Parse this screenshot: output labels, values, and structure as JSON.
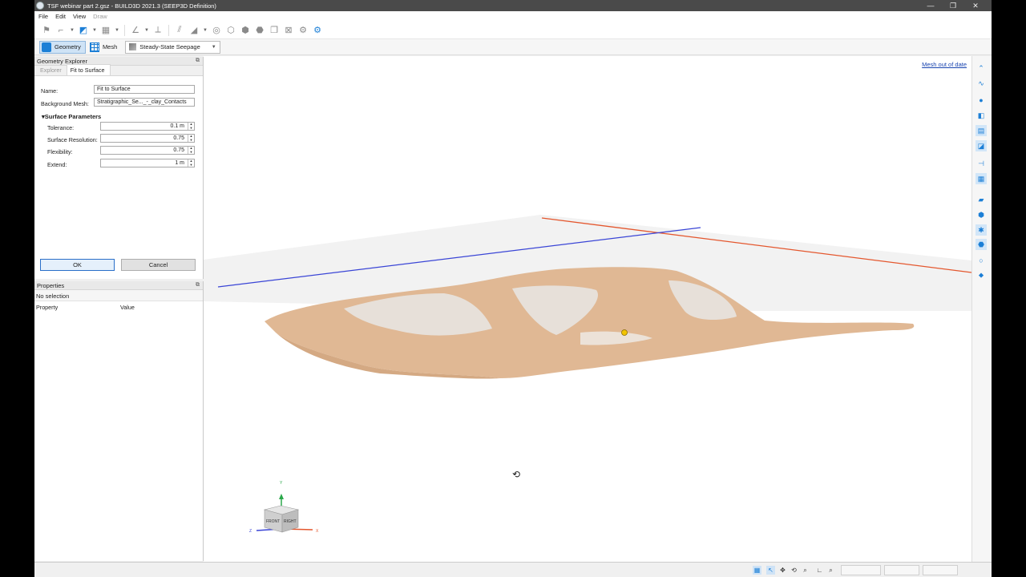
{
  "window": {
    "title": "TSF webinar part 2.gsz - BUILD3D 2021.3 (SEEP3D Definition)",
    "minimize": "—",
    "restore": "❐",
    "close": "✕"
  },
  "menu": {
    "file": "File",
    "edit": "Edit",
    "view": "View",
    "draw": "Draw"
  },
  "modes": {
    "geometry": "Geometry",
    "mesh": "Mesh",
    "analysis": "Steady-State Seepage"
  },
  "geometry_explorer": {
    "title": "Geometry Explorer",
    "tabs": [
      "Explorer",
      "Fit to Surface"
    ],
    "name_label": "Name:",
    "name_value": "Fit to Surface",
    "bg_mesh_label": "Background Mesh:",
    "bg_mesh_value": "Stratigraphic_Se..._-_clay_Contacts",
    "group_title": "▾Surface Parameters",
    "tolerance_label": "Tolerance:",
    "tolerance_value": "0.1 m",
    "resolution_label": "Surface Resolution:",
    "resolution_value": "0.75",
    "flexibility_label": "Flexibility:",
    "flexibility_value": "0.75",
    "extend_label": "Extend:",
    "extend_value": "1 m",
    "ok": "OK",
    "cancel": "Cancel"
  },
  "properties": {
    "title": "Properties",
    "selection": "No selection",
    "col_property": "Property",
    "col_value": "Value"
  },
  "viewport": {
    "status_link": "Mesh out of date",
    "cube_front": "FRONT",
    "cube_right": "RIGHT",
    "axis_y": "Y",
    "axis_z": "Z",
    "axis_x": "X"
  },
  "colors": {
    "surface": "#e0b894",
    "x_axis": "#e4572e",
    "z_axis": "#3a45d6",
    "accent": "#1c7fd6"
  }
}
